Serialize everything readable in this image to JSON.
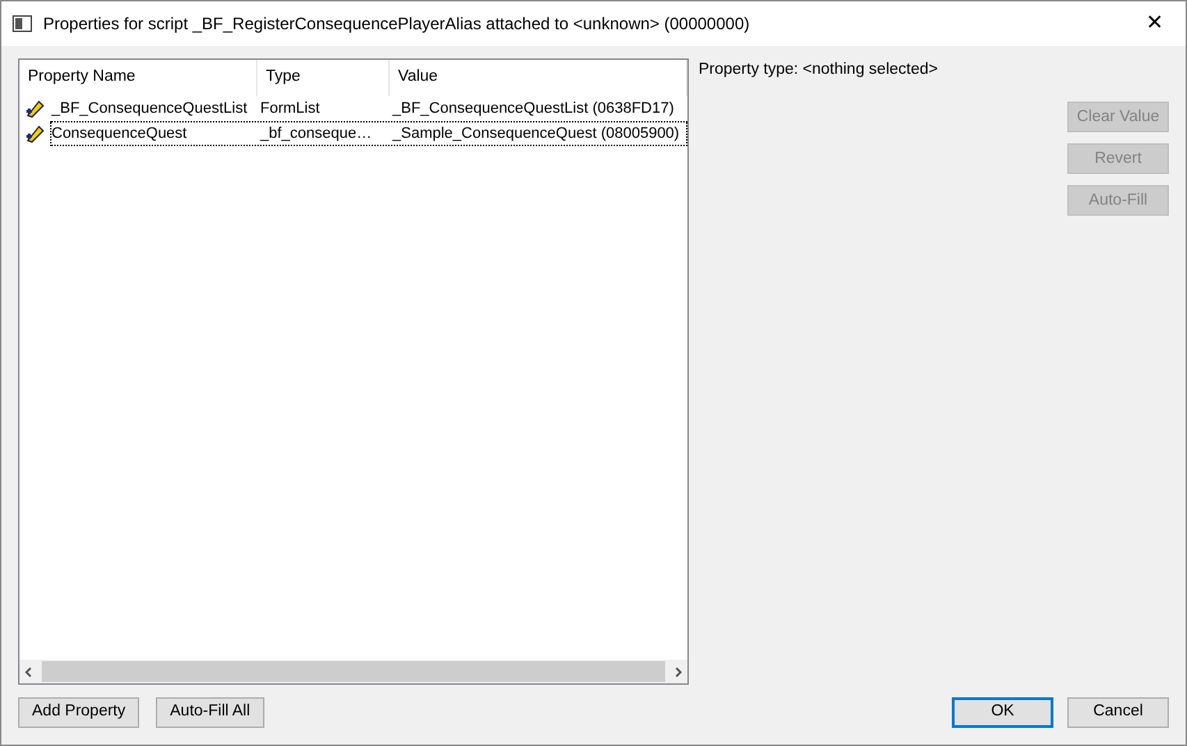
{
  "window": {
    "title": "Properties for script _BF_RegisterConsequencePlayerAlias attached to <unknown> (00000000)",
    "close": "✕"
  },
  "table": {
    "columns": [
      "Property Name",
      "Type",
      "Value"
    ],
    "rows": [
      {
        "cells": [
          "_BF_ConsequenceQuestList",
          "FormList",
          "_BF_ConsequenceQuestList (0638FD17)"
        ],
        "focused": false
      },
      {
        "cells": [
          "ConsequenceQuest",
          "_bf_conseque…",
          "_Sample_ConsequenceQuest (08005900)"
        ],
        "focused": true
      }
    ]
  },
  "property_type": "Property type: <nothing selected>",
  "side_buttons": [
    {
      "label": "Clear Value",
      "disabled": true
    },
    {
      "label": "Revert",
      "disabled": true
    },
    {
      "label": "Auto-Fill",
      "disabled": true
    }
  ],
  "bottom_left_buttons": [
    {
      "label": "Add Property",
      "default": false
    },
    {
      "label": "Auto-Fill All",
      "default": false
    }
  ],
  "bottom_right_buttons": [
    {
      "label": "OK",
      "default": true
    },
    {
      "label": "Cancel",
      "default": false
    }
  ]
}
